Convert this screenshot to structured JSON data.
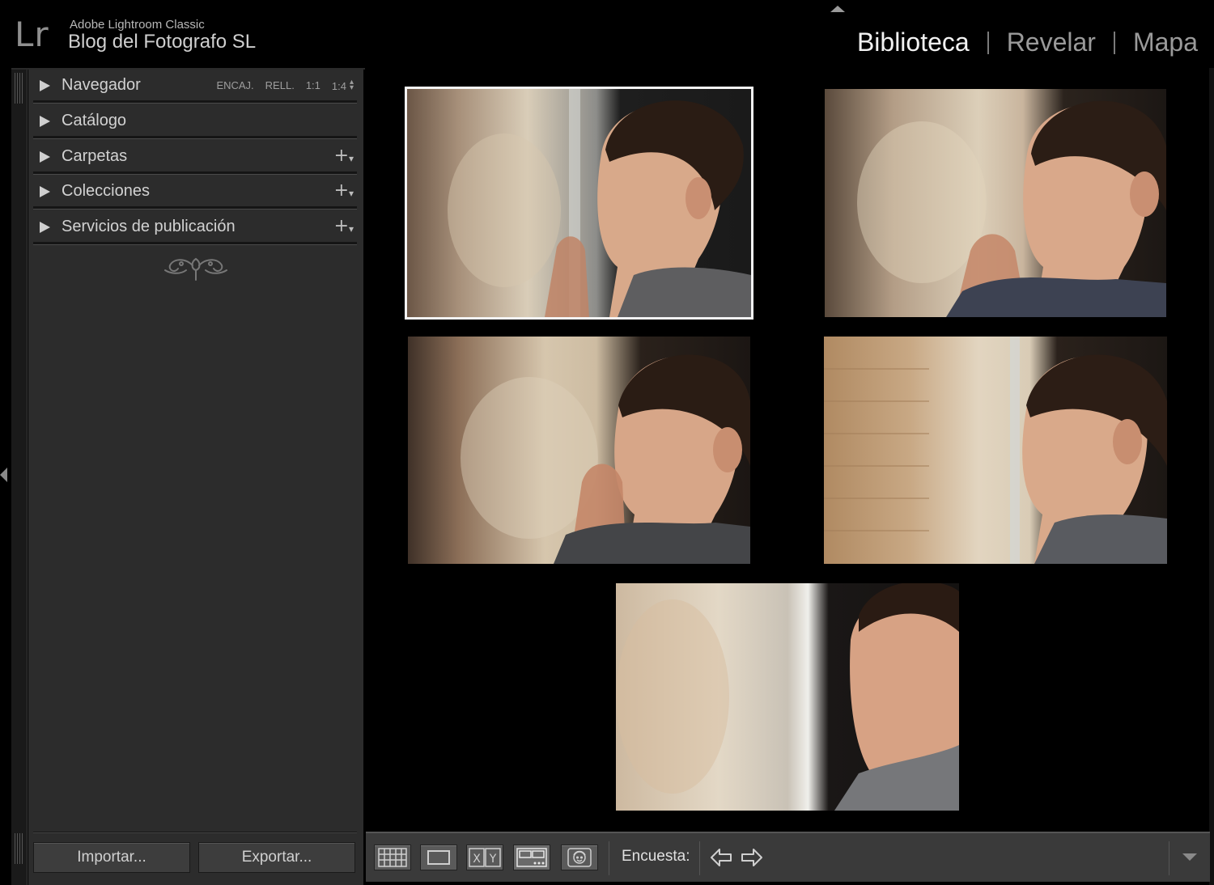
{
  "app": {
    "logo": "Lr",
    "product_name": "Adobe Lightroom Classic",
    "catalog_name": "Blog del Fotografo SL"
  },
  "modules": [
    {
      "label": "Biblioteca",
      "active": true
    },
    {
      "label": "Revelar",
      "active": false
    },
    {
      "label": "Mapa",
      "active": false
    }
  ],
  "left_panel": {
    "sections": [
      {
        "label": "Navegador",
        "has_plus": false
      },
      {
        "label": "Catálogo",
        "has_plus": false
      },
      {
        "label": "Carpetas",
        "has_plus": true
      },
      {
        "label": "Colecciones",
        "has_plus": true
      },
      {
        "label": "Servicios de publicación",
        "has_plus": true
      }
    ],
    "navigator_zoom": [
      "ENCAJ.",
      "RELL.",
      "1:1",
      "1:4"
    ],
    "plus_symbol": "+",
    "import_label": "Importar...",
    "export_label": "Exportar..."
  },
  "survey": {
    "photos": [
      {
        "name": "photo-1",
        "selected": true
      },
      {
        "name": "photo-2",
        "selected": false
      },
      {
        "name": "photo-3",
        "selected": false
      },
      {
        "name": "photo-4",
        "selected": false
      },
      {
        "name": "photo-5",
        "selected": false
      }
    ]
  },
  "toolbar": {
    "view_buttons": [
      "grid-view-icon",
      "loupe-view-icon",
      "compare-view-icon",
      "survey-view-icon",
      "people-view-icon"
    ],
    "compare_label": "XY",
    "label": "Encuesta:",
    "nav_icons": [
      "arrow-left-icon",
      "arrow-right-icon"
    ]
  },
  "colors": {
    "background": "#000000",
    "panel": "#2c2c2c",
    "toolbar": "#3a3a3a",
    "active_module": "#f2f2f2",
    "inactive_module": "#9a9a9a",
    "selection_border": "#f4f4f4"
  }
}
